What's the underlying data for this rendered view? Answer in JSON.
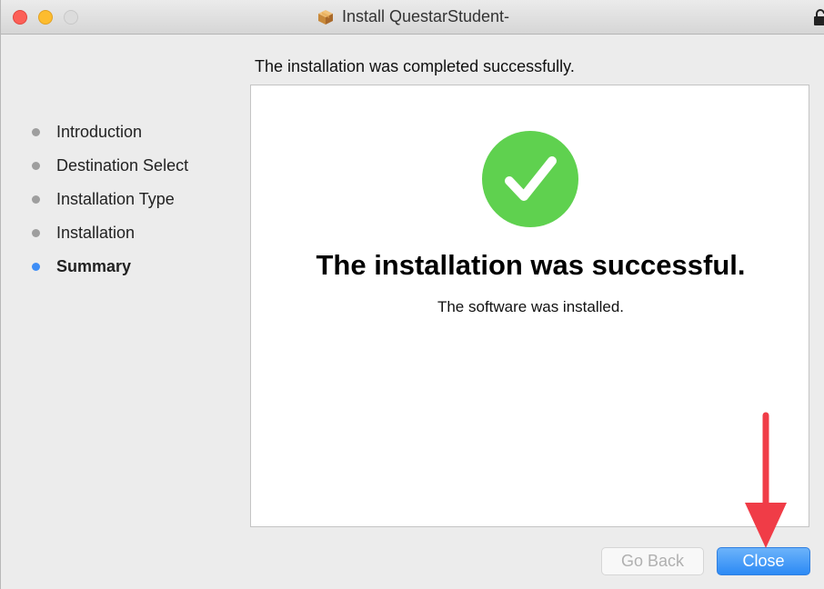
{
  "window": {
    "title": "Install QuestarStudent-",
    "title_icon": "package-icon"
  },
  "sidebar": {
    "items": [
      {
        "label": "Introduction",
        "active": false
      },
      {
        "label": "Destination Select",
        "active": false
      },
      {
        "label": "Installation Type",
        "active": false
      },
      {
        "label": "Installation",
        "active": false
      },
      {
        "label": "Summary",
        "active": true
      }
    ]
  },
  "main": {
    "header": "The installation was completed successfully.",
    "status_icon": "checkmark-icon",
    "title": "The installation was successful.",
    "message": "The software was installed."
  },
  "footer": {
    "go_back_label": "Go Back",
    "go_back_enabled": false,
    "close_label": "Close"
  },
  "colors": {
    "success_green": "#5fd14f",
    "accent_blue": "#3e8ef6",
    "annotation_red": "#f03c47"
  }
}
